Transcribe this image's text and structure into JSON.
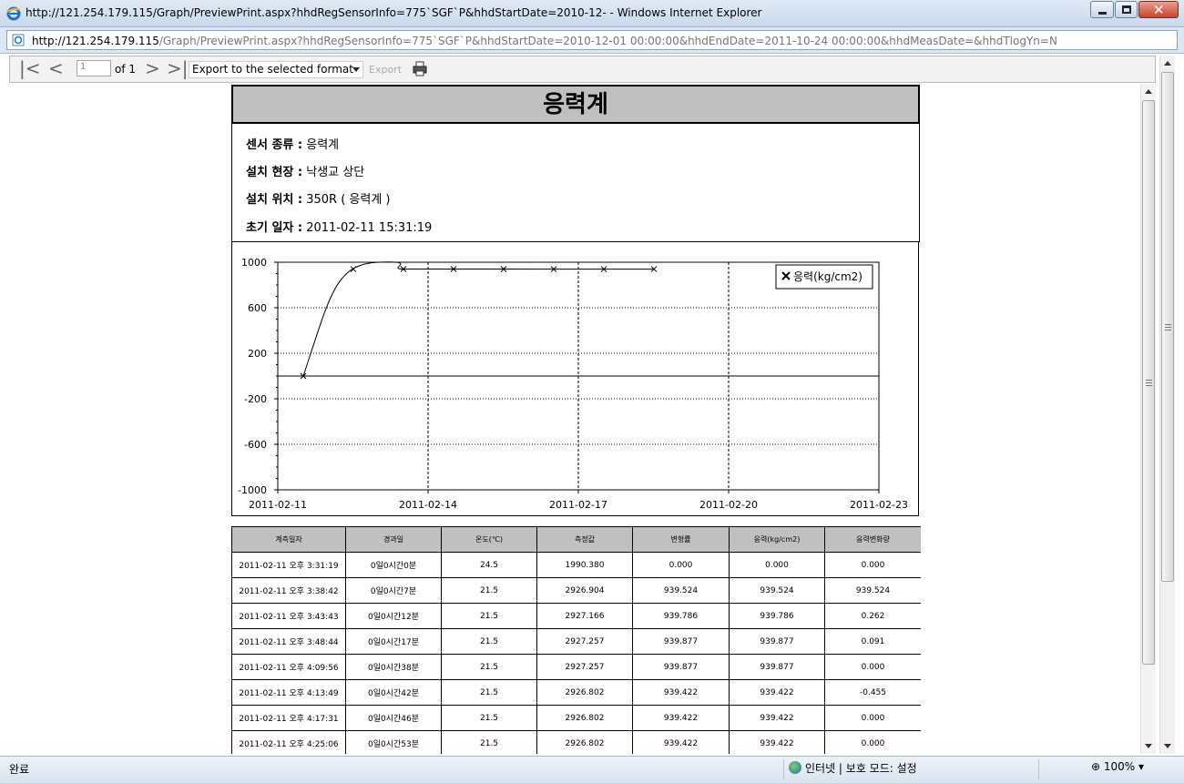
{
  "window": {
    "title": "http://121.254.179.115/Graph/PreviewPrint.aspx?hhdRegSensorInfo=775`SGF`P&hhdStartDate=2010-12- - Windows Internet Explorer"
  },
  "address": {
    "host": "http://121.254.179.115",
    "path": "/Graph/PreviewPrint.aspx?hhdRegSensorInfo=775`SGF`P&hhdStartDate=2010-12-01 00:00:00&hhdEndDate=2011-10-24 00:00:00&hhdMeasDate=&hhdTlogYn=N"
  },
  "toolbar": {
    "page_value": "1",
    "of_label": "of 1",
    "export_format": "Export to the selected format",
    "export_label": "Export"
  },
  "report": {
    "title": "응력계",
    "info": [
      {
        "label": "센서 종류 :",
        "value": "응력계"
      },
      {
        "label": "설치 현장 :",
        "value": "낙생교 상단"
      },
      {
        "label": "설치 위치 :",
        "value": "350R ( 응력계 )"
      },
      {
        "label": "초기 일자 :",
        "value": "2011-02-11 15:31:19"
      }
    ]
  },
  "chart_data": {
    "type": "line",
    "x": [
      "2011-02-11 15:31:19",
      "2011-02-11 15:38:42",
      "2011-02-11 15:43:43",
      "2011-02-11 15:48:44",
      "2011-02-11 16:09:56",
      "2011-02-11 16:13:49",
      "2011-02-11 16:17:31",
      "2011-02-11 16:25:06"
    ],
    "series": [
      {
        "name": "응력(kg/cm2)",
        "values": [
          0.0,
          939.524,
          939.786,
          939.877,
          939.877,
          939.422,
          939.422,
          939.422
        ],
        "marker": "x"
      }
    ],
    "ylim": [
      -1000,
      1000
    ],
    "yticks": [
      "1000",
      "600",
      "200",
      "-200",
      "-600",
      "-1000"
    ],
    "xticks": [
      "2011-02-11",
      "2011-02-14",
      "2011-02-17",
      "2011-02-20",
      "2011-02-23"
    ],
    "legend_position": "top-right",
    "grid": true
  },
  "table": {
    "headers": [
      "계측일자",
      "경과일",
      "온도(℃)",
      "측정값",
      "변형률",
      "응력(kg/cm2)",
      "응력변화량"
    ],
    "rows": [
      [
        "2011-02-11 오후 3:31:19",
        "0일0시간0분",
        "24.5",
        "1990.380",
        "0.000",
        "0.000",
        "0.000"
      ],
      [
        "2011-02-11 오후 3:38:42",
        "0일0시간7분",
        "21.5",
        "2926.904",
        "939.524",
        "939.524",
        "939.524"
      ],
      [
        "2011-02-11 오후 3:43:43",
        "0일0시간12분",
        "21.5",
        "2927.166",
        "939.786",
        "939.786",
        "0.262"
      ],
      [
        "2011-02-11 오후 3:48:44",
        "0일0시간17분",
        "21.5",
        "2927.257",
        "939.877",
        "939.877",
        "0.091"
      ],
      [
        "2011-02-11 오후 4:09:56",
        "0일0시간38분",
        "21.5",
        "2927.257",
        "939.877",
        "939.877",
        "0.000"
      ],
      [
        "2011-02-11 오후 4:13:49",
        "0일0시간42분",
        "21.5",
        "2926.802",
        "939.422",
        "939.422",
        "-0.455"
      ],
      [
        "2011-02-11 오후 4:17:31",
        "0일0시간46분",
        "21.5",
        "2926.802",
        "939.422",
        "939.422",
        "0.000"
      ],
      [
        "2011-02-11 오후 4:25:06",
        "0일0시간53분",
        "21.5",
        "2926.802",
        "939.422",
        "939.422",
        "0.000"
      ]
    ]
  },
  "status": {
    "text": "완료",
    "zone": "인터넷 | 보호 모드: 설정",
    "zoom": "100%"
  }
}
